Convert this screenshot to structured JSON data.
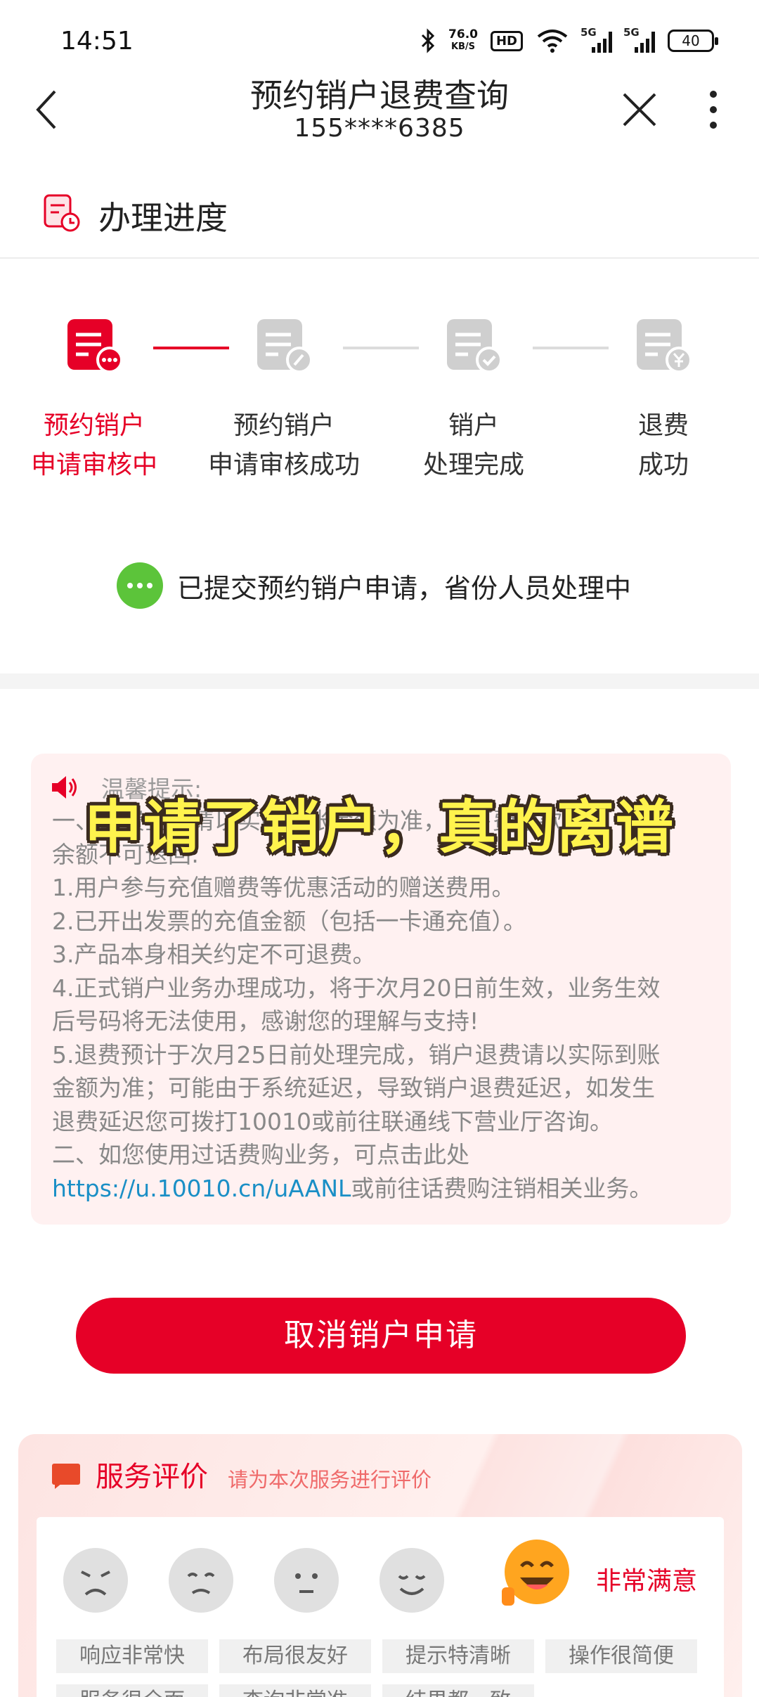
{
  "status_bar": {
    "time": "14:51",
    "net_speed": "76.0",
    "net_speed_unit": "KB/S",
    "hd_badge": "HD",
    "sig1_gen": "5G",
    "sig2_gen": "5G",
    "battery": "40",
    "icons": [
      "bluetooth-icon",
      "wifi-icon",
      "signal-icon",
      "battery-icon"
    ]
  },
  "header": {
    "title": "预约销户退费查询",
    "phone": "155****6385",
    "icons": [
      "back-arrow-icon",
      "close-icon",
      "more-vertical-icon"
    ]
  },
  "progress_section": {
    "title": "办理进度",
    "steps": [
      {
        "line1": "预约销户",
        "line2": "申请审核中",
        "active": true,
        "icon": "document-pending-icon"
      },
      {
        "line1": "预约销户",
        "line2": "申请审核成功",
        "active": false,
        "icon": "document-edit-icon"
      },
      {
        "line1": "销户",
        "line2": "处理完成",
        "active": false,
        "icon": "document-check-icon"
      },
      {
        "line1": "退费",
        "line2": "成功",
        "active": false,
        "icon": "document-yen-icon"
      }
    ],
    "status_message": "已提交预约销户申请，省份人员处理中"
  },
  "tips": {
    "title": "温馨提示:",
    "lines": [
      "一、退费金额请以实际到账金额为准，以下费用款部分",
      "余额不可退回:",
      "1.用户参与充值赠费等优惠活动的赠送费用。",
      "2.已开出发票的充值金额（包括一卡通充值）。",
      "3.产品本身相关约定不可退费。",
      "4.正式销户业务办理成功，将于次月20日前生效，业务生效",
      "后号码将无法使用，感谢您的理解与支持!",
      "5.退费预计于次月25日前处理完成，销户退费请以实际到账",
      "金额为准；可能由于系统延迟，导致销户退费延迟，如发生",
      "退费延迟您可拨打10010或前往联通线下营业厅咨询。",
      "二、如您使用过话费购业务，可点击此处"
    ],
    "link": "https://u.10010.cn/uAANL",
    "link_suffix": "或前往话费购注销相关业务。",
    "overlay_caption": "申请了销户，真的离谱"
  },
  "cancel_button": "取消销户申请",
  "evaluation": {
    "title": "服务评价",
    "subtitle": "请为本次服务进行评价",
    "selected_rating": "非常满意",
    "faces": [
      "very-dissatisfied-face-icon",
      "dissatisfied-face-icon",
      "neutral-face-icon",
      "satisfied-face-icon",
      "very-satisfied-face-icon"
    ],
    "tags": [
      "响应非常快",
      "布局很友好",
      "提示特清晰",
      "操作很简便",
      "服务很全面",
      "查询非常准",
      "结果都一致"
    ]
  },
  "colors": {
    "accent": "#e60027",
    "success": "#5cc43a",
    "link": "#1a8fc6",
    "caption": "#fff34d"
  }
}
